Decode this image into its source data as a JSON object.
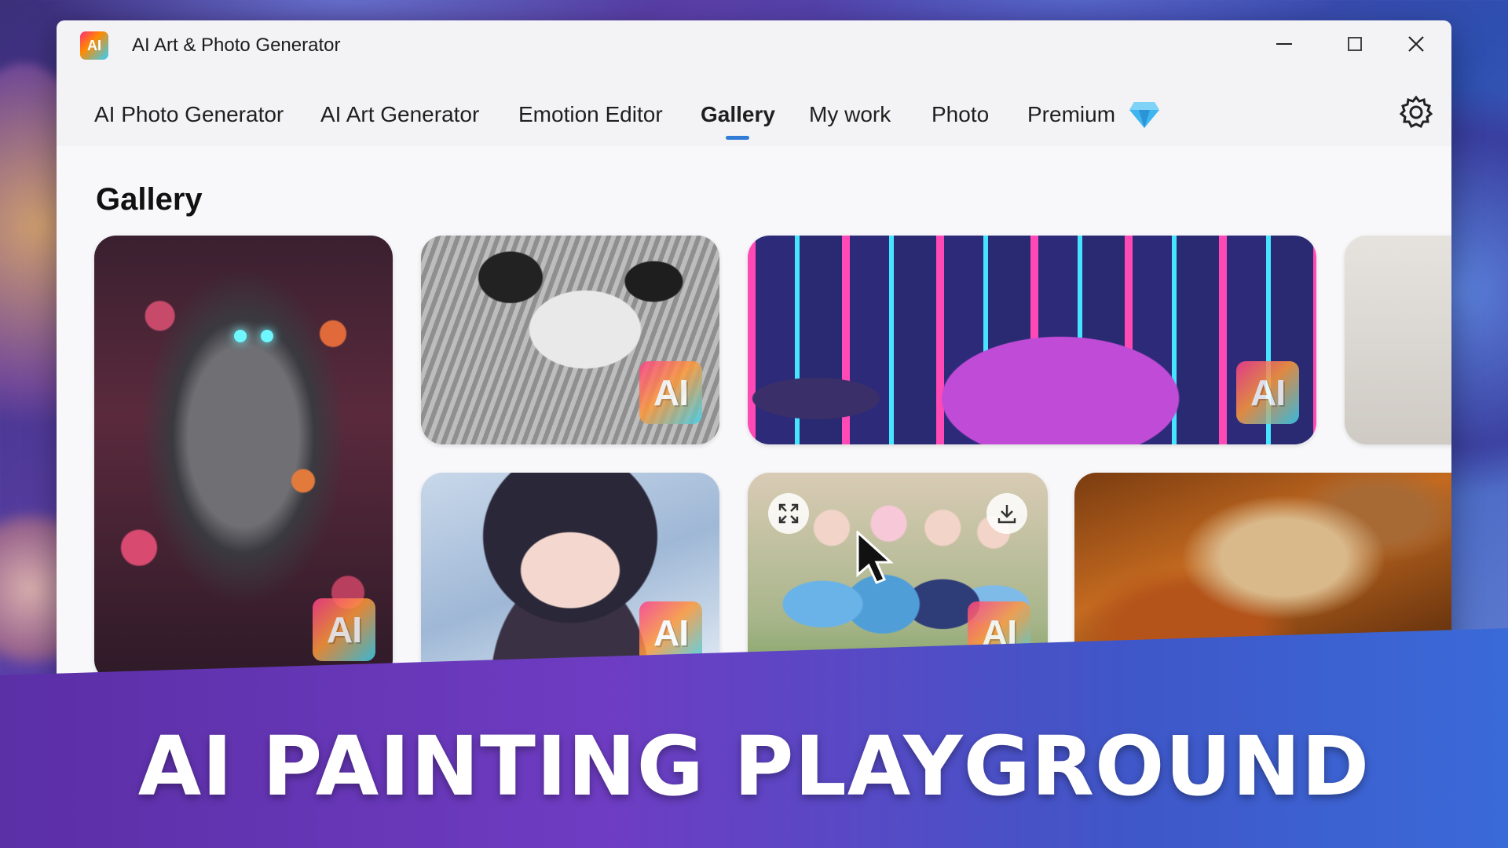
{
  "window": {
    "title": "AI Art & Photo Generator",
    "logo_text": "AI"
  },
  "nav": {
    "items": [
      {
        "label": "AI Photo Generator"
      },
      {
        "label": "AI Art Generator"
      },
      {
        "label": "Emotion Editor"
      },
      {
        "label": "Gallery"
      },
      {
        "label": "My work"
      },
      {
        "label": "Photo"
      },
      {
        "label": "Premium"
      }
    ],
    "active": "Gallery"
  },
  "page": {
    "title": "Gallery"
  },
  "gallery": {
    "badge_text": "AI",
    "items": [
      {
        "subject": "robot in flowers"
      },
      {
        "subject": "monochrome anime girl"
      },
      {
        "subject": "neon city sports car"
      },
      {
        "subject": "partially visible image"
      },
      {
        "subject": "anime girl portrait"
      },
      {
        "subject": "anime group of girls"
      },
      {
        "subject": "nebula"
      }
    ]
  },
  "banner": {
    "text": "AI PAINTING PLAYGROUND"
  },
  "colors": {
    "accent": "#2f7bd6",
    "banner_start": "#5b2fa6",
    "banner_end": "#3a6ad8"
  },
  "icons": [
    "app-logo-icon",
    "minimize-icon",
    "maximize-icon",
    "close-icon",
    "diamond-icon",
    "gear-icon",
    "expand-icon",
    "download-icon",
    "cursor-icon"
  ]
}
